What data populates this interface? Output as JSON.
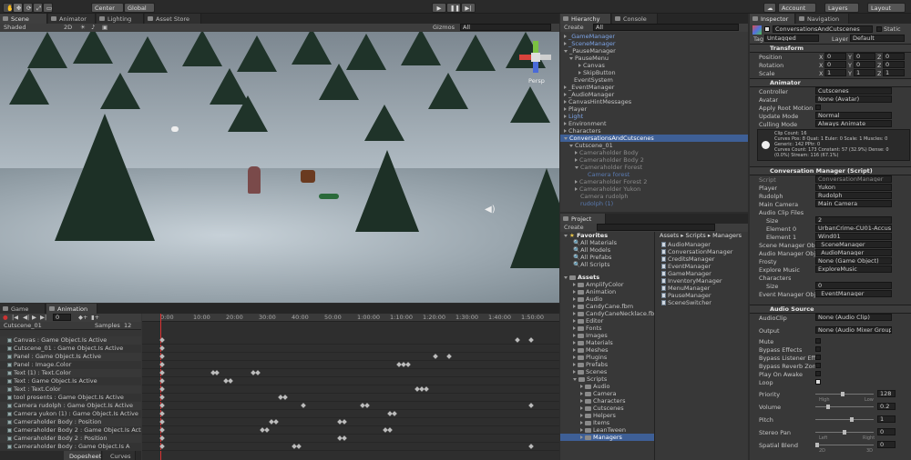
{
  "toolbar": {
    "pivot": "Center",
    "space": "Global",
    "account": "Account",
    "layers": "Layers",
    "layout": "Layout"
  },
  "scene": {
    "tabs": [
      "Scene",
      "Animator",
      "Lighting",
      "Asset Store"
    ],
    "shading": "Shaded",
    "mode": "2D",
    "gizmos": "Gizmos",
    "search": "All",
    "persp": "Persp"
  },
  "hierarchy": {
    "tabs": [
      "Hierarchy",
      "Console"
    ],
    "create": "Create",
    "search": "All",
    "items": [
      "_GameManager",
      "_SceneManager",
      "_PauseManager",
      "PauseMenu",
      "Canvas",
      "SkipButton",
      "EventSystem",
      "_EventManager",
      "_AudioManager",
      "CanvasHintMessages",
      "Player",
      "Light",
      "Environment",
      "Characters",
      "ConversationsAndCutscenes",
      "Cutscene_01",
      "Cameraholder Body",
      "Cameraholder Body 2",
      "Cameraholder Forest",
      "Camera forest",
      "Cameraholder Forest 2",
      "Cameraholder Yukon",
      "Camera rudolph",
      "rudolph (1)"
    ]
  },
  "project": {
    "tab": "Project",
    "create": "Create",
    "breadcrumb": "Assets ▸ Scripts ▸ Managers",
    "favorites_label": "Favorites",
    "favorites": [
      "All Materials",
      "All Models",
      "All Prefabs",
      "All Scripts"
    ],
    "assets_label": "Assets",
    "folders": [
      "AmplifyColor",
      "Animation",
      "Audio",
      "CandyCane.fbm",
      "CandyCaneNecklace.fbm",
      "Editor",
      "Fonts",
      "Images",
      "Materials",
      "Meshes",
      "Plugins",
      "Prefabs",
      "Scenes",
      "Scripts",
      "Audio",
      "Camera",
      "Characters",
      "Cutscenes",
      "Helpers",
      "Items",
      "LeanTween",
      "Managers"
    ],
    "files": [
      "AudioManager",
      "ConversationManager",
      "CreditsManager",
      "EventManager",
      "GameManager",
      "InventoryManager",
      "MenuManager",
      "PauseManager",
      "SceneSwitcher"
    ]
  },
  "animation": {
    "tabs": [
      "Game",
      "Animation"
    ],
    "clip": "Cutscene_01",
    "samples_label": "Samples",
    "samples": "12",
    "frame": "0",
    "ruler": [
      "0:00",
      "10:00",
      "20:00",
      "30:00",
      "40:00",
      "50:00",
      "1:00:00",
      "1:10:00",
      "1:20:00",
      "1:30:00",
      "1:40:00",
      "1:50:00"
    ],
    "tracks": [
      "Canvas : Game Object.Is Active",
      "Cutscene_01 : Game Object.Is Active",
      "Panel : Game Object.Is Active",
      "Panel : Image.Color",
      "Text (1) : Text.Color",
      "Text : Game Object.Is Active",
      "Text : Text.Color",
      "tool presents : Game Object.Is Active",
      "Camera rudolph : Game Object.Is Active",
      "Camera yukon (1) : Game Object.Is Active",
      "Cameraholder Body : Position",
      "Cameraholder Body 2 : Game Object.Is Active",
      "Cameraholder Body 2 : Position",
      "Cameraholder Body : Game Object.Is A"
    ],
    "footer_tabs": [
      "Dopesheet",
      "Curves"
    ]
  },
  "inspector": {
    "tabs": [
      "Inspector",
      "Navigation"
    ],
    "object_name": "ConversationsAndCutscenes",
    "static_label": "Static",
    "tag_label": "Tag",
    "tag": "Untagged",
    "layer_label": "Layer",
    "layer": "Default",
    "transform": {
      "title": "Transform",
      "rows": [
        {
          "label": "Position",
          "x": "0",
          "y": "0",
          "z": "0"
        },
        {
          "label": "Rotation",
          "x": "0",
          "y": "0",
          "z": "0"
        },
        {
          "label": "Scale",
          "x": "1",
          "y": "1",
          "z": "1"
        }
      ]
    },
    "animator": {
      "title": "Animator",
      "controller_label": "Controller",
      "controller": "Cutscenes",
      "avatar_label": "Avatar",
      "avatar": "None (Avatar)",
      "root_motion_label": "Apply Root Motion",
      "update_mode_label": "Update Mode",
      "update_mode": "Normal",
      "culling_label": "Culling Mode",
      "culling": "Always Animate",
      "info": [
        "Clip Count: 16",
        "Curves Pos: 8 Quat: 1 Euler: 0 Scale: 1 Muscles: 0",
        "Generic: 142 PPtr: 0",
        "Curves Count: 173 Constant: 57 (32.9%) Dense: 0",
        "(0.0%) Stream: 116 (67.1%)"
      ]
    },
    "conversation": {
      "title": "Conversation Manager (Script)",
      "fields": [
        {
          "label": "Script",
          "value": "ConversationManager"
        },
        {
          "label": "Player",
          "value": "Yukon"
        },
        {
          "label": "Rudolph",
          "value": "Rudolph"
        },
        {
          "label": "Main Camera",
          "value": "Main Camera"
        }
      ],
      "clips_label": "Audio Clip Files",
      "size_label": "Size",
      "size": "2",
      "elements": [
        {
          "label": "Element 0",
          "value": "UrbanCrime-CU01-Accus"
        },
        {
          "label": "Element 1",
          "value": "Wind01"
        }
      ],
      "more": [
        {
          "label": "Scene Manager Obj",
          "value": "_SceneManager"
        },
        {
          "label": "Audio Manager Obje",
          "value": "_AudioManager"
        },
        {
          "label": "Frosty",
          "value": "None (Game Object)"
        },
        {
          "label": "Explore Music",
          "value": "ExploreMusic"
        }
      ],
      "characters_label": "Characters",
      "char_size": "0",
      "event_label": "Event Manager Obje",
      "event_value": "_EventManager"
    },
    "audio": {
      "title": "Audio Source",
      "clip_label": "AudioClip",
      "clip": "None (Audio Clip)",
      "output_label": "Output",
      "output": "None (Audio Mixer Group)",
      "toggles": [
        "Mute",
        "Bypass Effects",
        "Bypass Listener Effe",
        "Bypass Reverb Zone",
        "Play On Awake",
        "Loop"
      ],
      "priority_label": "Priority",
      "priority": "128",
      "high": "High",
      "low": "Low",
      "volume_label": "Volume",
      "volume": "0.2",
      "pitch_label": "Pitch",
      "pitch": "1",
      "stereo_label": "Stereo Pan",
      "stereo": "0",
      "left": "Left",
      "right": "Right",
      "spatial_label": "Spatial Blend",
      "spatial": "0",
      "twod": "2D",
      "threed": "3D"
    }
  }
}
